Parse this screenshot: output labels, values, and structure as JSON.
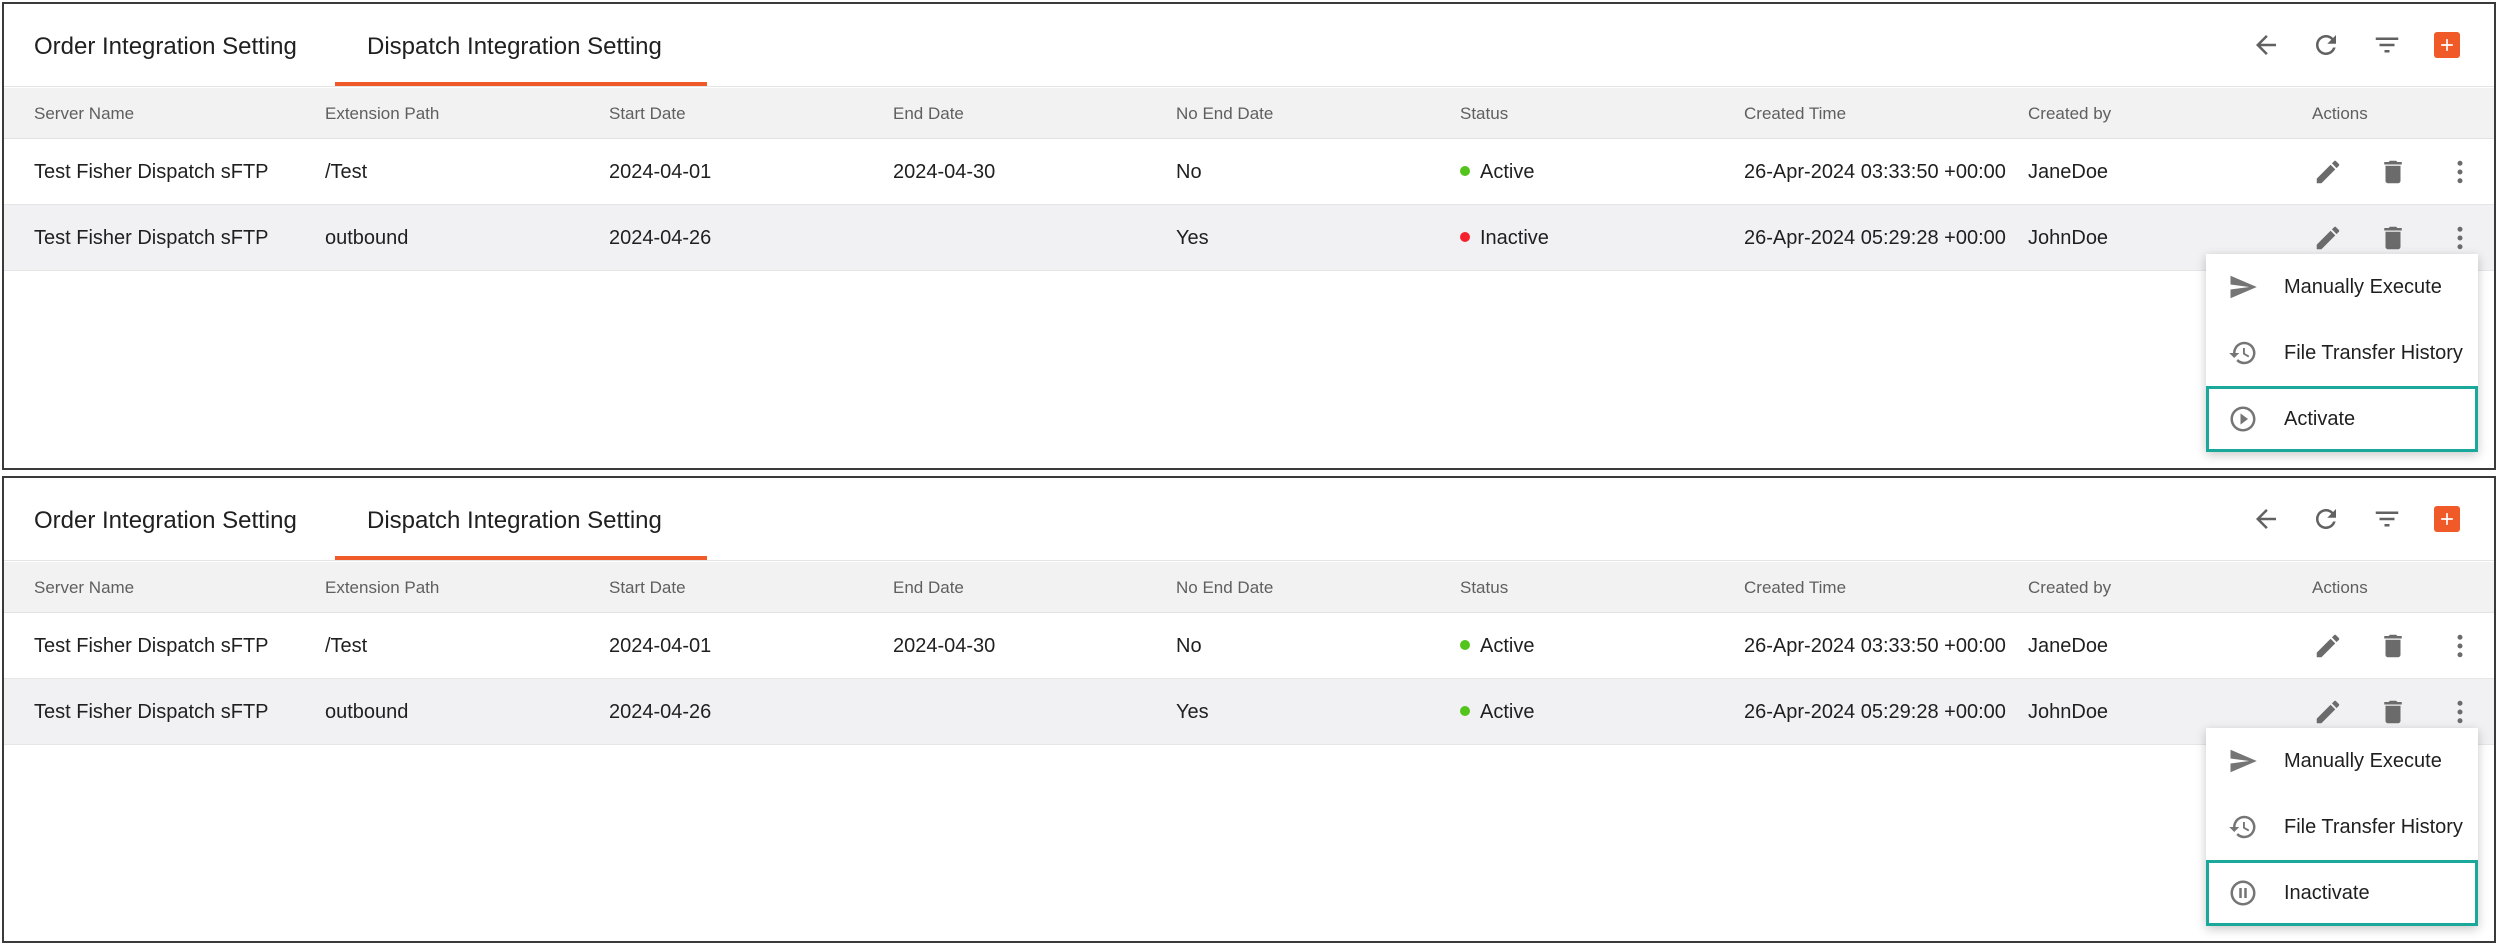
{
  "colors": {
    "accent": "#f05a28",
    "active": "#52c41a",
    "inactive": "#f5222d",
    "highlight": "#19a89a"
  },
  "panels": [
    {
      "tabs": [
        {
          "label": "Order Integration Setting"
        },
        {
          "label": "Dispatch Integration Setting",
          "selected": true
        }
      ],
      "toolbar": [
        "back-arrow-icon",
        "refresh-icon",
        "filter-icon",
        "add-icon"
      ],
      "columns": [
        "Server Name",
        "Extension Path",
        "Start Date",
        "End Date",
        "No End Date",
        "Status",
        "Created Time",
        "Created by",
        "Actions"
      ],
      "rows": [
        {
          "server": "Test Fisher Dispatch sFTP",
          "path": "/Test",
          "start": "2024-04-01",
          "end": "2024-04-30",
          "no_end": "No",
          "status": "Active",
          "created_time": "26-Apr-2024 03:33:50 +00:00",
          "created_by": "JaneDoe"
        },
        {
          "server": "Test Fisher Dispatch sFTP",
          "path": "outbound",
          "start": "2024-04-26",
          "end": "",
          "no_end": "Yes",
          "status": "Inactive",
          "created_time": "26-Apr-2024 05:29:28 +00:00",
          "created_by": "JohnDoe"
        }
      ],
      "menu": [
        {
          "label": "Manually Execute",
          "icon": "send-icon"
        },
        {
          "label": "File Transfer History",
          "icon": "history-icon"
        },
        {
          "label": "Activate",
          "icon": "play-circle-icon",
          "highlighted": true
        }
      ]
    },
    {
      "tabs": [
        {
          "label": "Order Integration Setting"
        },
        {
          "label": "Dispatch Integration Setting",
          "selected": true
        }
      ],
      "toolbar": [
        "back-arrow-icon",
        "refresh-icon",
        "filter-icon",
        "add-icon"
      ],
      "columns": [
        "Server Name",
        "Extension Path",
        "Start Date",
        "End Date",
        "No End Date",
        "Status",
        "Created Time",
        "Created by",
        "Actions"
      ],
      "rows": [
        {
          "server": "Test Fisher Dispatch sFTP",
          "path": "/Test",
          "start": "2024-04-01",
          "end": "2024-04-30",
          "no_end": "No",
          "status": "Active",
          "created_time": "26-Apr-2024 03:33:50 +00:00",
          "created_by": "JaneDoe"
        },
        {
          "server": "Test Fisher Dispatch sFTP",
          "path": "outbound",
          "start": "2024-04-26",
          "end": "",
          "no_end": "Yes",
          "status": "Active",
          "created_time": "26-Apr-2024 05:29:28 +00:00",
          "created_by": "JohnDoe"
        }
      ],
      "menu": [
        {
          "label": "Manually Execute",
          "icon": "send-icon"
        },
        {
          "label": "File Transfer History",
          "icon": "history-icon"
        },
        {
          "label": "Inactivate",
          "icon": "pause-circle-icon",
          "highlighted": true
        }
      ]
    }
  ]
}
